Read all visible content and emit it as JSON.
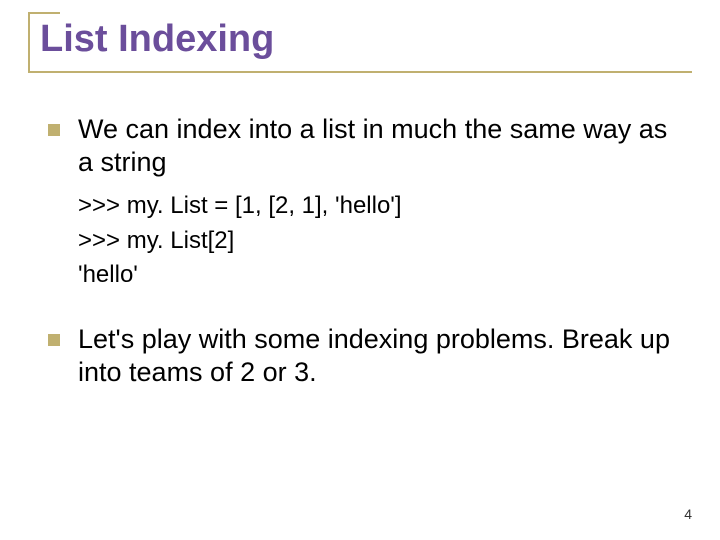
{
  "title": "List Indexing",
  "bullets": {
    "b1": "We can index into a list in much the same way as a string",
    "b2": "Let's play with some indexing problems. Break up into teams of 2 or 3."
  },
  "code": {
    "l1": ">>> my. List = [1, [2, 1], 'hello']",
    "l2": ">>> my. List[2]",
    "l3": "'hello'"
  },
  "page_number": "4"
}
